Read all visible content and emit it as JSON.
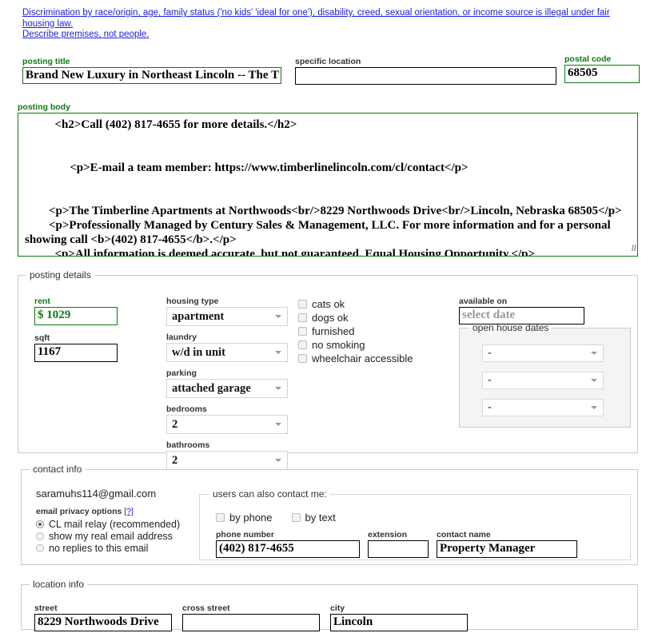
{
  "disclaimer": {
    "line1": "Discrimination by race/origin, age, family status ('no kids' 'ideal for one'), disability, creed, sexual orientation, or income source is illegal under fair housing law.",
    "line2": "Describe premises, not people."
  },
  "top_fields": {
    "posting_title_label": "posting title",
    "posting_title_value": "Brand New Luxury in Northeast Lincoln -- The T",
    "specific_location_label": "specific location",
    "specific_location_value": "",
    "postal_code_label": "postal code",
    "postal_code_value": "68505"
  },
  "posting_body": {
    "label": "posting body",
    "value": "          <h2>Call (402) 817-4655 for more details.</h2>\n\n\n               <p>E-mail a team member: https://www.timberlinelincoln.com/cl/contact</p>\n\n\n        <p>The Timberline Apartments at Northwoods<br/>8229 Northwoods Drive<br/>Lincoln, Nebraska 68505</p>\n        <p>Professionally Managed by Century Sales & Management, LLC. For more information and for a personal showing call <b>(402) 817-4655</b>.</p>\n          <p>All information is deemed accurate, but not guaranteed. Equal Housing Opportunity.</p>\n     </body>",
    "resize_handle": "//"
  },
  "posting_details": {
    "legend": "posting details",
    "rent_label": "rent",
    "rent_value": "$ 1029",
    "sqft_label": "sqft",
    "sqft_value": "1167",
    "selects": [
      {
        "label": "housing type",
        "value": "apartment"
      },
      {
        "label": "laundry",
        "value": "w/d in unit"
      },
      {
        "label": "parking",
        "value": "attached garage"
      },
      {
        "label": "bedrooms",
        "value": "2"
      },
      {
        "label": "bathrooms",
        "value": "2"
      }
    ],
    "checkboxes": [
      {
        "label": "cats ok",
        "checked": false
      },
      {
        "label": "dogs ok",
        "checked": false
      },
      {
        "label": "furnished",
        "checked": false
      },
      {
        "label": "no smoking",
        "checked": false
      },
      {
        "label": "wheelchair accessible",
        "checked": false
      }
    ],
    "available_on_label": "available on",
    "available_on_placeholder": "select date",
    "open_house": {
      "legend": "open house dates",
      "values": [
        "-",
        "-",
        "-"
      ]
    }
  },
  "contact_info": {
    "legend": "contact info",
    "email": "saramuhs114@gmail.com",
    "privacy_label": "email privacy options",
    "privacy_help": "[?]",
    "privacy_options": [
      {
        "label": "CL mail relay (recommended)",
        "selected": true
      },
      {
        "label": "show my real email address",
        "selected": false
      },
      {
        "label": "no replies to this email",
        "selected": false
      }
    ],
    "also_contact": {
      "legend": "users can also contact me:",
      "checkboxes": [
        {
          "label": "by phone",
          "checked": false
        },
        {
          "label": "by text",
          "checked": false
        }
      ],
      "phone_label": "phone number",
      "phone_value": "(402) 817-4655",
      "extension_label": "extension",
      "extension_value": "",
      "contact_name_label": "contact name",
      "contact_name_value": "Property Manager"
    }
  },
  "location_info": {
    "legend": "location info",
    "fields": [
      {
        "label": "street",
        "value": "8229 Northwoods Drive"
      },
      {
        "label": "cross street",
        "value": ""
      },
      {
        "label": "city",
        "value": "Lincoln"
      }
    ]
  },
  "colors": {
    "link": "#2020dd",
    "green": "#117711",
    "label": "#333333",
    "border": "#cccccc"
  }
}
